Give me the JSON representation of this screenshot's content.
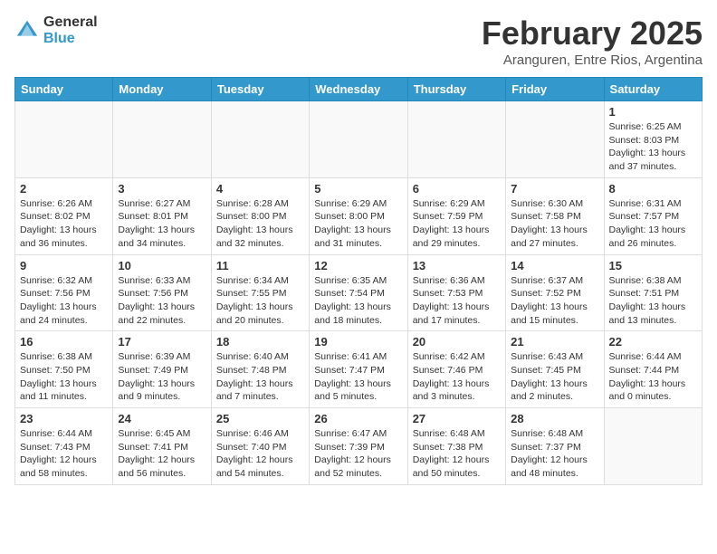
{
  "logo": {
    "general": "General",
    "blue": "Blue"
  },
  "title": "February 2025",
  "location": "Aranguren, Entre Rios, Argentina",
  "weekdays": [
    "Sunday",
    "Monday",
    "Tuesday",
    "Wednesday",
    "Thursday",
    "Friday",
    "Saturday"
  ],
  "weeks": [
    [
      {
        "day": "",
        "info": ""
      },
      {
        "day": "",
        "info": ""
      },
      {
        "day": "",
        "info": ""
      },
      {
        "day": "",
        "info": ""
      },
      {
        "day": "",
        "info": ""
      },
      {
        "day": "",
        "info": ""
      },
      {
        "day": "1",
        "info": "Sunrise: 6:25 AM\nSunset: 8:03 PM\nDaylight: 13 hours and 37 minutes."
      }
    ],
    [
      {
        "day": "2",
        "info": "Sunrise: 6:26 AM\nSunset: 8:02 PM\nDaylight: 13 hours and 36 minutes."
      },
      {
        "day": "3",
        "info": "Sunrise: 6:27 AM\nSunset: 8:01 PM\nDaylight: 13 hours and 34 minutes."
      },
      {
        "day": "4",
        "info": "Sunrise: 6:28 AM\nSunset: 8:00 PM\nDaylight: 13 hours and 32 minutes."
      },
      {
        "day": "5",
        "info": "Sunrise: 6:29 AM\nSunset: 8:00 PM\nDaylight: 13 hours and 31 minutes."
      },
      {
        "day": "6",
        "info": "Sunrise: 6:29 AM\nSunset: 7:59 PM\nDaylight: 13 hours and 29 minutes."
      },
      {
        "day": "7",
        "info": "Sunrise: 6:30 AM\nSunset: 7:58 PM\nDaylight: 13 hours and 27 minutes."
      },
      {
        "day": "8",
        "info": "Sunrise: 6:31 AM\nSunset: 7:57 PM\nDaylight: 13 hours and 26 minutes."
      }
    ],
    [
      {
        "day": "9",
        "info": "Sunrise: 6:32 AM\nSunset: 7:56 PM\nDaylight: 13 hours and 24 minutes."
      },
      {
        "day": "10",
        "info": "Sunrise: 6:33 AM\nSunset: 7:56 PM\nDaylight: 13 hours and 22 minutes."
      },
      {
        "day": "11",
        "info": "Sunrise: 6:34 AM\nSunset: 7:55 PM\nDaylight: 13 hours and 20 minutes."
      },
      {
        "day": "12",
        "info": "Sunrise: 6:35 AM\nSunset: 7:54 PM\nDaylight: 13 hours and 18 minutes."
      },
      {
        "day": "13",
        "info": "Sunrise: 6:36 AM\nSunset: 7:53 PM\nDaylight: 13 hours and 17 minutes."
      },
      {
        "day": "14",
        "info": "Sunrise: 6:37 AM\nSunset: 7:52 PM\nDaylight: 13 hours and 15 minutes."
      },
      {
        "day": "15",
        "info": "Sunrise: 6:38 AM\nSunset: 7:51 PM\nDaylight: 13 hours and 13 minutes."
      }
    ],
    [
      {
        "day": "16",
        "info": "Sunrise: 6:38 AM\nSunset: 7:50 PM\nDaylight: 13 hours and 11 minutes."
      },
      {
        "day": "17",
        "info": "Sunrise: 6:39 AM\nSunset: 7:49 PM\nDaylight: 13 hours and 9 minutes."
      },
      {
        "day": "18",
        "info": "Sunrise: 6:40 AM\nSunset: 7:48 PM\nDaylight: 13 hours and 7 minutes."
      },
      {
        "day": "19",
        "info": "Sunrise: 6:41 AM\nSunset: 7:47 PM\nDaylight: 13 hours and 5 minutes."
      },
      {
        "day": "20",
        "info": "Sunrise: 6:42 AM\nSunset: 7:46 PM\nDaylight: 13 hours and 3 minutes."
      },
      {
        "day": "21",
        "info": "Sunrise: 6:43 AM\nSunset: 7:45 PM\nDaylight: 13 hours and 2 minutes."
      },
      {
        "day": "22",
        "info": "Sunrise: 6:44 AM\nSunset: 7:44 PM\nDaylight: 13 hours and 0 minutes."
      }
    ],
    [
      {
        "day": "23",
        "info": "Sunrise: 6:44 AM\nSunset: 7:43 PM\nDaylight: 12 hours and 58 minutes."
      },
      {
        "day": "24",
        "info": "Sunrise: 6:45 AM\nSunset: 7:41 PM\nDaylight: 12 hours and 56 minutes."
      },
      {
        "day": "25",
        "info": "Sunrise: 6:46 AM\nSunset: 7:40 PM\nDaylight: 12 hours and 54 minutes."
      },
      {
        "day": "26",
        "info": "Sunrise: 6:47 AM\nSunset: 7:39 PM\nDaylight: 12 hours and 52 minutes."
      },
      {
        "day": "27",
        "info": "Sunrise: 6:48 AM\nSunset: 7:38 PM\nDaylight: 12 hours and 50 minutes."
      },
      {
        "day": "28",
        "info": "Sunrise: 6:48 AM\nSunset: 7:37 PM\nDaylight: 12 hours and 48 minutes."
      },
      {
        "day": "",
        "info": ""
      }
    ]
  ]
}
